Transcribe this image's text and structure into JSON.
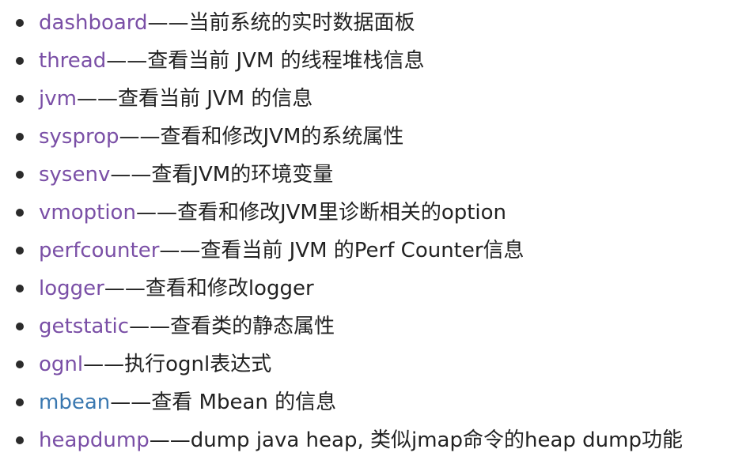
{
  "colors": {
    "link_visited": "#7a4fa6",
    "link_unvisited": "#3a78b0",
    "text": "#222222",
    "bullet": "#2b2b2b"
  },
  "items": [
    {
      "command": "dashboard",
      "description": "——当前系统的实时数据面板",
      "visited": true
    },
    {
      "command": "thread",
      "description": "——查看当前 JVM 的线程堆栈信息",
      "visited": true
    },
    {
      "command": "jvm",
      "description": "——查看当前 JVM 的信息",
      "visited": true
    },
    {
      "command": "sysprop",
      "description": "——查看和修改JVM的系统属性",
      "visited": true
    },
    {
      "command": "sysenv",
      "description": "——查看JVM的环境变量",
      "visited": true
    },
    {
      "command": "vmoption",
      "description": "——查看和修改JVM里诊断相关的option",
      "visited": true
    },
    {
      "command": "perfcounter",
      "description": "——查看当前 JVM 的Perf Counter信息",
      "visited": true
    },
    {
      "command": "logger",
      "description": "——查看和修改logger",
      "visited": true
    },
    {
      "command": "getstatic",
      "description": "——查看类的静态属性",
      "visited": true
    },
    {
      "command": "ognl",
      "description": "——执行ognl表达式",
      "visited": true
    },
    {
      "command": "mbean",
      "description": "——查看 Mbean 的信息",
      "visited": false
    },
    {
      "command": "heapdump",
      "description": "——dump java heap, 类似jmap命令的heap dump功能",
      "visited": true
    }
  ]
}
